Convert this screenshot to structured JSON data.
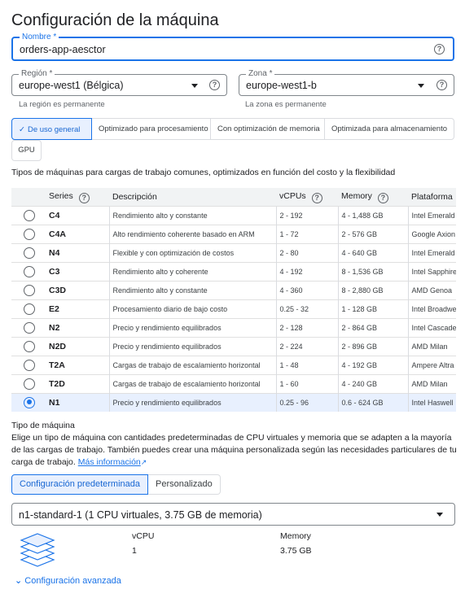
{
  "page": {
    "title": "Configuración de la máquina"
  },
  "name_field": {
    "label": "Nombre *",
    "value": "orders-app-aesctor"
  },
  "region_field": {
    "label": "Región *",
    "value": "europe-west1 (Bélgica)",
    "hint": "La región es permanente"
  },
  "zone_field": {
    "label": "Zona *",
    "value": "europe-west1-b",
    "hint": "La zona es permanente"
  },
  "family_tabs": [
    {
      "label": "De uso general",
      "active": true
    },
    {
      "label": "Optimizado para procesamiento",
      "active": false
    },
    {
      "label": "Con optimización de memoria",
      "active": false
    },
    {
      "label": "Optimizada para almacenamiento",
      "active": false
    },
    {
      "label": "GPU",
      "active": false
    }
  ],
  "family_description": "Tipos de máquinas para cargas de trabajo comunes, optimizados en función del costo y la flexibilidad",
  "series_table": {
    "headers": {
      "series": "Series",
      "description": "Descripción",
      "vcpus": "vCPUs",
      "memory": "Memory",
      "platform": "Plataforma"
    },
    "rows": [
      {
        "series": "C4",
        "description": "Rendimiento alto y constante",
        "vcpus": "2 - 192",
        "memory": "4 - 1,488 GB",
        "platform": "Intel Emerald Rapids",
        "selected": false
      },
      {
        "series": "C4A",
        "description": "Alto rendimiento coherente basado en ARM",
        "vcpus": "1 - 72",
        "memory": "2 - 576 GB",
        "platform": "Google Axion",
        "selected": false
      },
      {
        "series": "N4",
        "description": "Flexible y con optimización de costos",
        "vcpus": "2 - 80",
        "memory": "4 - 640 GB",
        "platform": "Intel Emerald Rapids",
        "selected": false
      },
      {
        "series": "C3",
        "description": "Rendimiento alto y coherente",
        "vcpus": "4 - 192",
        "memory": "8 - 1,536 GB",
        "platform": "Intel Sapphire Rapids",
        "selected": false
      },
      {
        "series": "C3D",
        "description": "Rendimiento alto y constante",
        "vcpus": "4 - 360",
        "memory": "8 - 2,880 GB",
        "platform": "AMD Genoa",
        "selected": false
      },
      {
        "series": "E2",
        "description": "Procesamiento diario de bajo costo",
        "vcpus": "0.25 - 32",
        "memory": "1 - 128 GB",
        "platform": "Intel Broadwell",
        "selected": false
      },
      {
        "series": "N2",
        "description": "Precio y rendimiento equilibrados",
        "vcpus": "2 - 128",
        "memory": "2 - 864 GB",
        "platform": "Intel Cascade Lake",
        "selected": false
      },
      {
        "series": "N2D",
        "description": "Precio y rendimiento equilibrados",
        "vcpus": "2 - 224",
        "memory": "2 - 896 GB",
        "platform": "AMD Milan",
        "selected": false
      },
      {
        "series": "T2A",
        "description": "Cargas de trabajo de escalamiento horizontal",
        "vcpus": "1 - 48",
        "memory": "4 - 192 GB",
        "platform": "Ampere Altra",
        "selected": false
      },
      {
        "series": "T2D",
        "description": "Cargas de trabajo de escalamiento horizontal",
        "vcpus": "1 - 60",
        "memory": "4 - 240 GB",
        "platform": "AMD Milan",
        "selected": false
      },
      {
        "series": "N1",
        "description": "Precio y rendimiento equilibrados",
        "vcpus": "0.25 - 96",
        "memory": "0.6 - 624 GB",
        "platform": "Intel Haswell",
        "selected": true
      }
    ]
  },
  "machine_type": {
    "title": "Tipo de máquina",
    "description": "Elige un tipo de máquina con cantidades predeterminadas de CPU virtuales y memoria que se adapten a la mayoría de las cargas de trabajo. También puedes crear una máquina personalizada según las necesidades particulares de tu carga de trabajo.",
    "link": "Más información",
    "preset_button": "Configuración predeterminada",
    "custom_button": "Personalizado",
    "selected": "n1-standard-1 (1 CPU virtuales, 3.75 GB de memoria)",
    "vcpu_label": "vCPU",
    "vcpu_value": "1",
    "memory_label": "Memory",
    "memory_value": "3.75 GB"
  },
  "advanced": {
    "label": "Configuración avanzada"
  },
  "colors": {
    "accent": "#1a73e8",
    "selected_bg": "#e8f0fe",
    "header_bg": "#f1f3f4"
  }
}
